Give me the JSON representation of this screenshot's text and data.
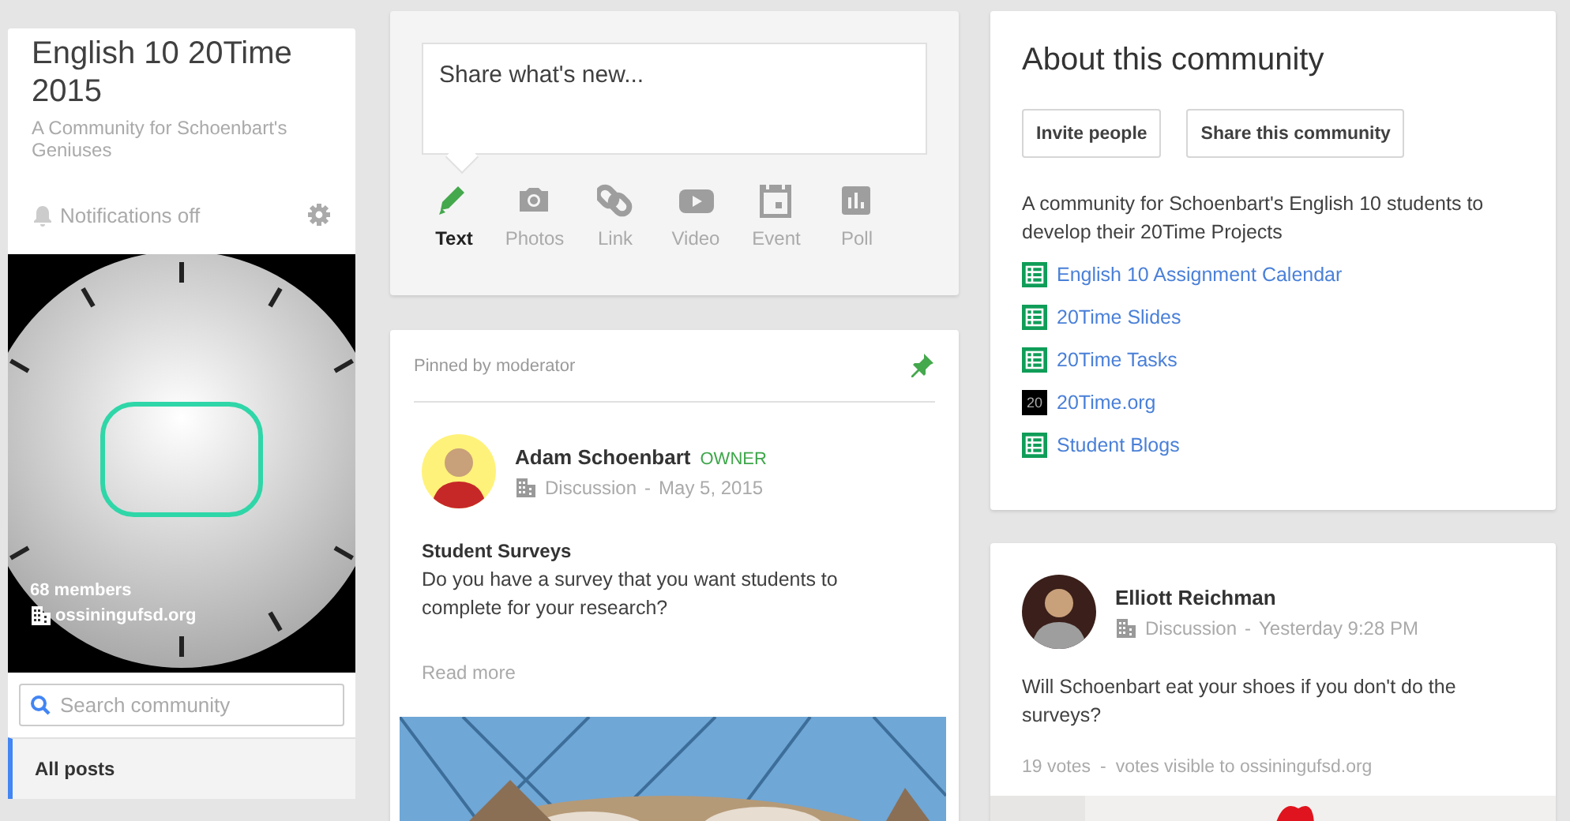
{
  "sidebar": {
    "title": "English 10 20Time 2015",
    "subtitle": "A Community for Schoenbart's Geniuses",
    "notifications": {
      "label": "Notifications off",
      "on": false
    },
    "cover": {
      "kind": "picture",
      "members": "68 members",
      "domain": "ossiningufsd.org"
    },
    "search": {
      "placeholder": "Search community"
    },
    "items": [
      {
        "label": "All posts",
        "selected": true
      }
    ]
  },
  "composer": {
    "placeholder": "Share what's new...",
    "types": [
      {
        "kind": "text",
        "label": "Text",
        "selected": true
      },
      {
        "kind": "photos",
        "label": "Photos",
        "selected": false
      },
      {
        "kind": "link",
        "label": "Link",
        "selected": false
      },
      {
        "kind": "video",
        "label": "Video",
        "selected": false
      },
      {
        "kind": "event",
        "label": "Event",
        "selected": false
      },
      {
        "kind": "poll",
        "label": "Poll",
        "selected": false
      }
    ]
  },
  "pinned_post": {
    "pinned_label": "Pinned by moderator",
    "author": "Adam Schoenbart",
    "badge": "OWNER",
    "category": "Discussion",
    "separator": "-",
    "date": "May 5, 2015",
    "title": "Student Surveys",
    "body": "Do you have a survey that you want students to complete for your research?",
    "read_more": "Read more"
  },
  "about": {
    "title": "About this community",
    "buttons": [
      "Invite people",
      "Share this community"
    ],
    "description": "A community for Schoenbart's English 10 students to develop their 20Time Projects",
    "links": [
      {
        "kind": "sheet",
        "label": "English 10 Assignment Calendar"
      },
      {
        "kind": "sheet",
        "label": "20Time Slides"
      },
      {
        "kind": "sheet",
        "label": "20Time Tasks"
      },
      {
        "kind": "site",
        "icon_text": "20",
        "label": "20Time.org"
      },
      {
        "kind": "sheet",
        "label": "Student Blogs"
      }
    ]
  },
  "poll_post": {
    "author": "Elliott Reichman",
    "category": "Discussion",
    "separator": "-",
    "date": "Yesterday 9:28 PM",
    "body": "Will Schoenbart eat your shoes if you don't do the surveys?",
    "votes": "19 votes",
    "votes_separator": "-",
    "visibility": "votes visible to ossiningufsd.org"
  }
}
